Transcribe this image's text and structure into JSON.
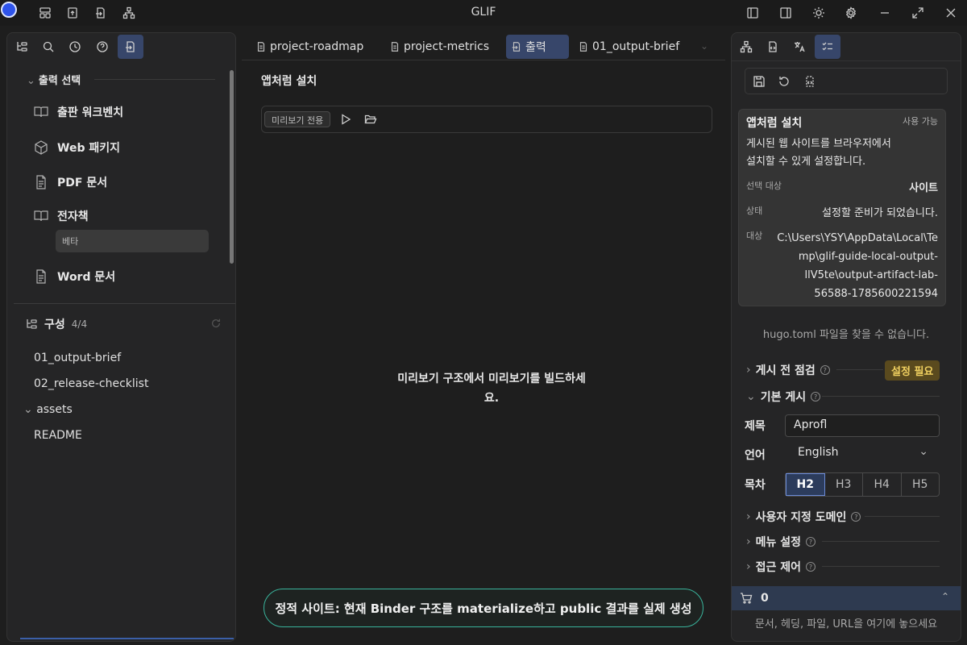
{
  "app": {
    "title": "GLIF"
  },
  "left": {
    "output_section": "출력 선택",
    "outputs": [
      {
        "label": "출판 워크벤치",
        "icon": "book-open-icon"
      },
      {
        "label": "Web 패키지",
        "icon": "package-icon"
      },
      {
        "label": "PDF 문서",
        "icon": "file-text-icon"
      },
      {
        "label": "전자책",
        "icon": "book-icon",
        "badge": "베타"
      },
      {
        "label": "Word 문서",
        "icon": "file-text-icon"
      }
    ],
    "structure": {
      "title": "구성",
      "count": "4/4"
    },
    "tree": [
      "01_output-brief",
      "02_release-checklist",
      "assets",
      "README"
    ]
  },
  "tabs": [
    {
      "label": "project-roadmap",
      "active": false
    },
    {
      "label": "project-metrics",
      "active": false
    },
    {
      "label": "출력",
      "active": true
    },
    {
      "label": "01_output-brief",
      "active": false
    }
  ],
  "center": {
    "title": "앱처럼 설치",
    "preview_badge": "미리보기 전용",
    "empty_message": "미리보기 구조에서 미리보기를 빌드하세요.",
    "toast": "정적 사이트: 현재 Binder 구조를 materialize하고 public 결과를 실제 생성"
  },
  "right": {
    "card": {
      "title": "앱처럼 설치",
      "availability": "사용 가능",
      "desc_line1": "게시된 웹 사이트를 브라우저에서",
      "desc_line2": "설치할 수 있게 설정합니다.",
      "target_label": "선택 대상",
      "target_value": "사이트",
      "status_label": "상태",
      "status_value": "설정할 준비가 되었습니다.",
      "path_label": "대상",
      "path_lines": [
        "C:\\Users\\YSY\\AppData\\Local\\Te",
        "mp\\glif-guide-local-output-",
        "llV5te\\output-artifact-lab-",
        "56588-1785600221594"
      ]
    },
    "hugo_message": "hugo.toml 파일을 찾을 수 없습니다.",
    "sections": {
      "prepublish": "게시 전 점검",
      "prepublish_badge": "설정 필요",
      "basic": "기본 게시",
      "custom_domain": "사용자 지정 도메인",
      "menu": "메뉴 설정",
      "access": "접근 제어"
    },
    "form": {
      "title_label": "제목",
      "title_value": "Aprofl",
      "lang_label": "언어",
      "lang_value": "English",
      "toc_label": "목차",
      "toc_options": [
        "H2",
        "H3",
        "H4",
        "H5"
      ]
    },
    "cart": {
      "count": "0"
    },
    "drop_hint": "문서, 헤딩, 파일, URL을 여기에 놓으세요"
  }
}
